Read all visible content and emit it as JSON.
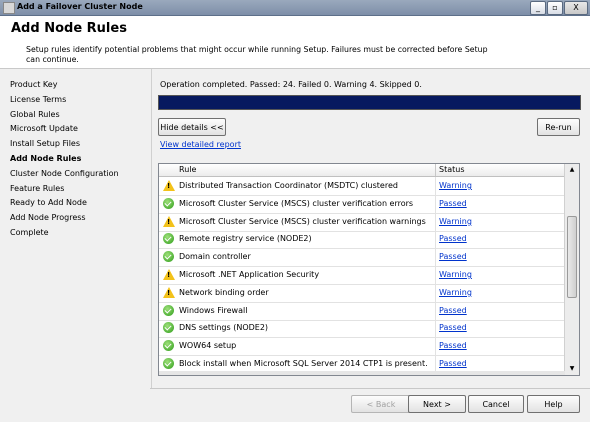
{
  "window": {
    "title": "Add a Failover Cluster Node",
    "min_icon": "minimize-icon",
    "max_icon": "maximize-icon",
    "close_label": "X"
  },
  "header": {
    "title": "Add Node Rules",
    "description": "Setup rules identify potential problems that might occur while running Setup. Failures must be corrected before Setup can continue."
  },
  "sidebar": {
    "items": [
      {
        "label": "Product Key",
        "active": false
      },
      {
        "label": "License Terms",
        "active": false
      },
      {
        "label": "Global Rules",
        "active": false
      },
      {
        "label": "Microsoft Update",
        "active": false
      },
      {
        "label": "Install Setup Files",
        "active": false
      },
      {
        "label": "Add Node Rules",
        "active": true
      },
      {
        "label": "Cluster Node Configuration",
        "active": false
      },
      {
        "label": "Feature Rules",
        "active": false
      },
      {
        "label": "Ready to Add Node",
        "active": false
      },
      {
        "label": "Add Node Progress",
        "active": false
      },
      {
        "label": "Complete",
        "active": false
      }
    ]
  },
  "main": {
    "status_text": "Operation completed. Passed: 24.   Failed 0.   Warning 4.   Skipped 0.",
    "progress_fraction": 1.0,
    "hide_details_label": "Hide details <<",
    "rerun_label": "Re-run",
    "view_report_label": "View detailed report",
    "columns": {
      "rule": "Rule",
      "status": "Status"
    },
    "rows": [
      {
        "icon": "warning-icon",
        "rule": "Distributed Transaction Coordinator (MSDTC) clustered",
        "status": "Warning"
      },
      {
        "icon": "passed-icon",
        "rule": "Microsoft Cluster Service (MSCS) cluster verification errors",
        "status": "Passed"
      },
      {
        "icon": "warning-icon",
        "rule": "Microsoft Cluster Service (MSCS) cluster verification warnings",
        "status": "Warning"
      },
      {
        "icon": "passed-icon",
        "rule": "Remote registry service (NODE2)",
        "status": "Passed"
      },
      {
        "icon": "passed-icon",
        "rule": "Domain controller",
        "status": "Passed"
      },
      {
        "icon": "warning-icon",
        "rule": "Microsoft .NET Application Security",
        "status": "Warning"
      },
      {
        "icon": "warning-icon",
        "rule": "Network binding order",
        "status": "Warning"
      },
      {
        "icon": "passed-icon",
        "rule": "Windows Firewall",
        "status": "Passed"
      },
      {
        "icon": "passed-icon",
        "rule": "DNS settings (NODE2)",
        "status": "Passed"
      },
      {
        "icon": "passed-icon",
        "rule": "WOW64 setup",
        "status": "Passed"
      },
      {
        "icon": "passed-icon",
        "rule": "Block install when Microsoft SQL Server 2014 CTP1 is present.",
        "status": "Passed"
      }
    ]
  },
  "footer": {
    "back_label": "< Back",
    "next_label": "Next >",
    "cancel_label": "Cancel",
    "help_label": "Help"
  },
  "colors": {
    "progress": "#07195f",
    "link": "#0033cc",
    "passed": "#2e9d1a",
    "warning": "#f3c21a"
  }
}
